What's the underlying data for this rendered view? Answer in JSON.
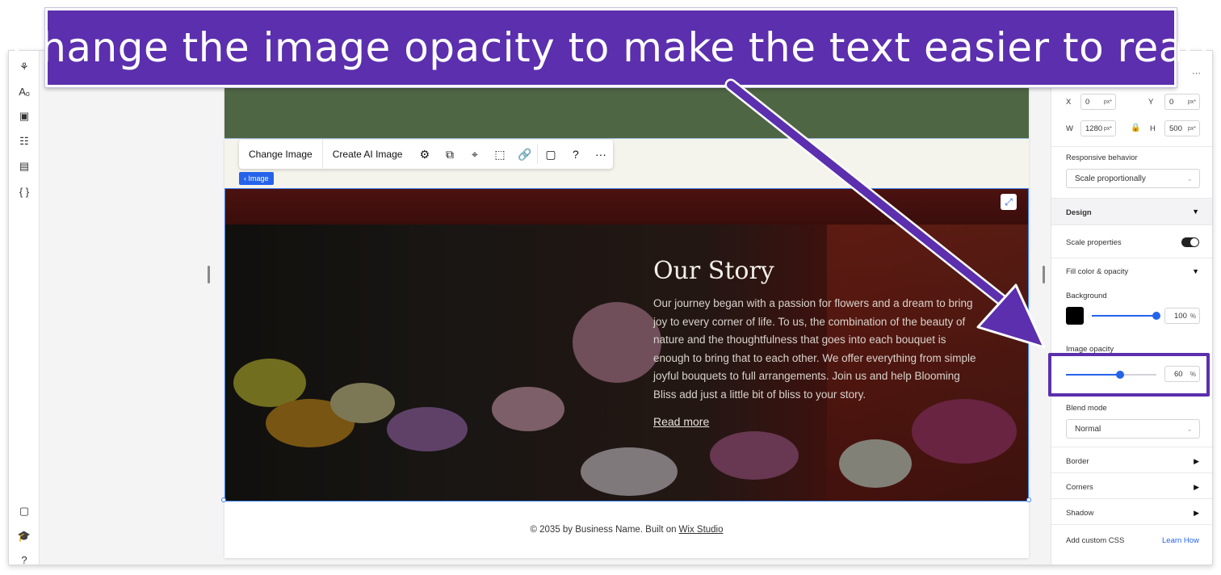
{
  "banner": {
    "text": "Change the image opacity to make the text easier to read"
  },
  "toolbar": {
    "change_image": "Change Image",
    "create_ai_image": "Create AI Image",
    "more": "···"
  },
  "image_tag": "‹ Image",
  "story": {
    "title": "Our Story",
    "body": "Our journey began with a passion for flowers and a dream to bring joy to every corner of life. To us, the combination of the beauty of nature and the thoughtfulness that goes into each bouquet is enough to bring that to each other. We offer everything from simple joyful bouquets to full arrangements. Join us and help Blooming Bliss add just a little bit of bliss to your story.",
    "read_more": "Read more"
  },
  "footer": {
    "text": "© 2035 by Business Name. Built on",
    "link": "Wix Studio"
  },
  "panel": {
    "more_icon": "···",
    "x_label": "X",
    "x_value": "0",
    "x_unit": "px*",
    "y_label": "Y",
    "y_value": "0",
    "y_unit": "px*",
    "w_label": "W",
    "w_value": "1280",
    "w_unit": "px*",
    "h_label": "H",
    "h_value": "500",
    "h_unit": "px*",
    "responsive_label": "Responsive behavior",
    "responsive_value": "Scale proportionally",
    "design_label": "Design",
    "scale_properties_label": "Scale properties",
    "fill_label": "Fill color & opacity",
    "background_label": "Background",
    "background_value": "100",
    "background_unit": "%",
    "background_color": "#000000",
    "image_opacity_label": "Image opacity",
    "image_opacity_value": "60",
    "image_opacity_unit": "%",
    "blend_mode_label": "Blend mode",
    "blend_mode_value": "Normal",
    "border_label": "Border",
    "corners_label": "Corners",
    "shadow_label": "Shadow",
    "custom_css_label": "Add custom CSS",
    "learn_how": "Learn How"
  },
  "colors": {
    "accent": "#2563eb",
    "annotation": "#5b2fad",
    "header_green": "#4e6644"
  },
  "levels": {
    "background_opacity": 1.0,
    "image_opacity": 0.6
  }
}
